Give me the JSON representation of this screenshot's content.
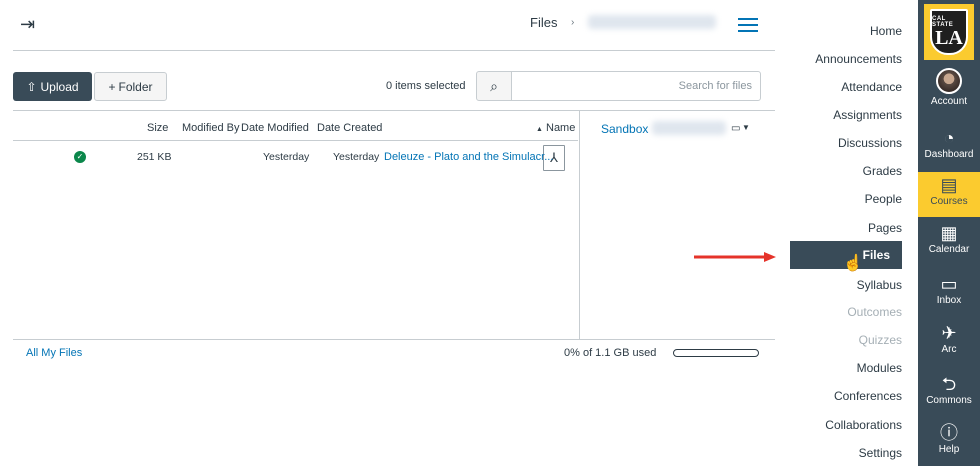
{
  "header": {
    "collapse_icon": "collapse-sidebar-icon",
    "breadcrumb_current": "Files",
    "breadcrumb_separator": "›"
  },
  "toolbar": {
    "upload_label": "Upload",
    "folder_label": "Folder",
    "selected_count": "0 items selected",
    "search_placeholder": "Search for files"
  },
  "tree": {
    "root_label": "Sandbox"
  },
  "table": {
    "columns": {
      "name": "Name",
      "sort_indicator": "▲",
      "date_created": "Date Created",
      "date_modified": "Date Modified",
      "modified_by": "Modified By",
      "size": "Size"
    },
    "rows": [
      {
        "name": "Deleuze - Plato and the Simulacr...",
        "date_created": "Yesterday",
        "date_modified": "Yesterday",
        "modified_by": "",
        "size": "251 KB",
        "status": "published"
      }
    ]
  },
  "footer": {
    "quota_text": "0% of 1.1 GB used",
    "quota_fraction": 0,
    "all_files_link": "All My Files"
  },
  "course_nav": {
    "items": [
      "Home",
      "Announcements",
      "Attendance",
      "Assignments",
      "Discussions",
      "Grades",
      "People",
      "Pages",
      "Files",
      "Syllabus",
      "Outcomes",
      "Quizzes",
      "Modules",
      "Conferences",
      "Collaborations",
      "Settings"
    ]
  },
  "global_nav": {
    "logo_top": "CAL STATE",
    "logo_main": "LA",
    "items": [
      "Account",
      "Dashboard",
      "Courses",
      "Calendar",
      "Inbox",
      "Arc",
      "Commons",
      "Help"
    ]
  },
  "colors": {
    "nav_bg": "#394b58",
    "accent_yellow": "#fbcb2f",
    "link_blue": "#0374b5",
    "success_green": "#0b874b",
    "callout_red": "#e5332a"
  }
}
